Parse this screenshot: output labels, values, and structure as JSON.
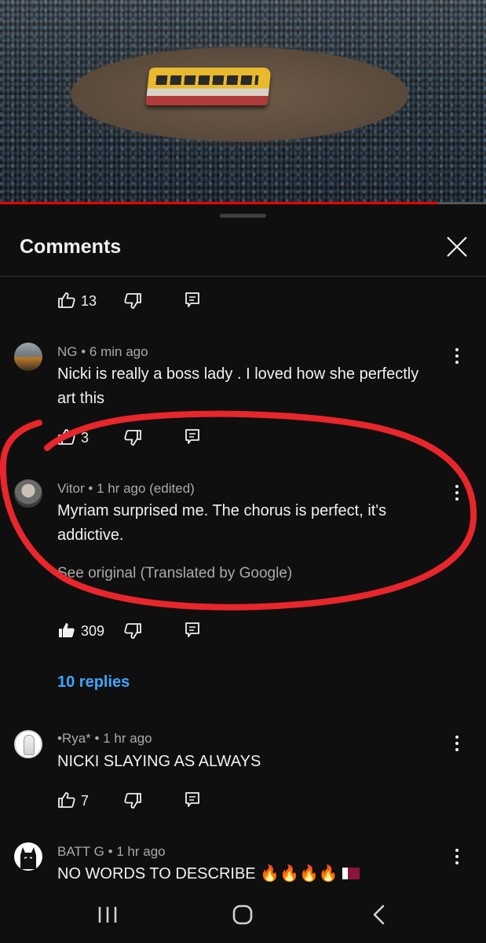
{
  "video": {
    "progress_percent": 90
  },
  "sheet": {
    "title": "Comments"
  },
  "comments": [
    {
      "like_count": "13"
    },
    {
      "author": "NG",
      "sep": "•",
      "time": "6 min ago",
      "text_line1": "Nicki is really a boss lady . I loved how she perfectly",
      "text_line2": "art this",
      "like_count": "3"
    },
    {
      "author": "Vitor",
      "sep": "•",
      "time": "1 hr ago (edited)",
      "text_line1": "Myriam surprised me. The chorus is perfect, it's",
      "text_line2": "addictive.",
      "translated": "See original (Translated by Google)",
      "like_count": "309",
      "liked": true,
      "replies": "10 replies"
    },
    {
      "author": "•Rya*",
      "sep": "•",
      "time": "1 hr ago",
      "text_line1": "NICKI SLAYING AS ALWAYS",
      "like_count": "7"
    },
    {
      "author": "BATT G",
      "sep": "•",
      "time": "1 hr ago",
      "text_line1": "NO WORDS TO DESCRIBE 🔥🔥🔥🔥",
      "flag": "qatar-flag"
    }
  ],
  "icons": {
    "like": "thumb-up-icon",
    "dislike": "thumb-down-icon",
    "reply": "reply-icon",
    "more": "more-vert-icon",
    "close": "close-icon"
  },
  "colors": {
    "background": "#0f0f0f",
    "accent_link": "#3ea6ff",
    "progress": "#ee0000",
    "annotation": "#e8262b"
  }
}
